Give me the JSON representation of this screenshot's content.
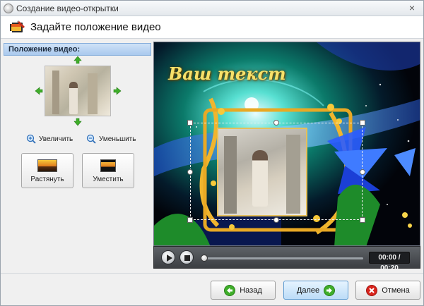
{
  "window": {
    "title": "Создание видео-открытки",
    "close_glyph": "×",
    "icon": "app-disc-icon"
  },
  "header": {
    "title": "Задайте положение видео",
    "icon": "film-edit-icon"
  },
  "left_panel": {
    "heading": "Положение видео:",
    "zoom_in_label": "Увеличить",
    "zoom_out_label": "Уменьшить",
    "stretch_label": "Растянуть",
    "fit_label": "Уместить",
    "arrows": [
      "arrow-up-icon",
      "arrow-down-icon",
      "arrow-left-icon",
      "arrow-right-icon"
    ]
  },
  "preview": {
    "overlay_text": "Ваш текст"
  },
  "player": {
    "time": "00:00 / 00:20",
    "progress": 0.0,
    "play_icon": "play-icon",
    "stop_icon": "stop-icon"
  },
  "footer": {
    "back_label": "Назад",
    "next_label": "Далее",
    "cancel_label": "Отмена"
  },
  "colors": {
    "accent_green": "#3fae2a",
    "cancel_red": "#d9241c",
    "heading_blue": "#a9c9ee",
    "banner_gold": "#f6e16a"
  }
}
